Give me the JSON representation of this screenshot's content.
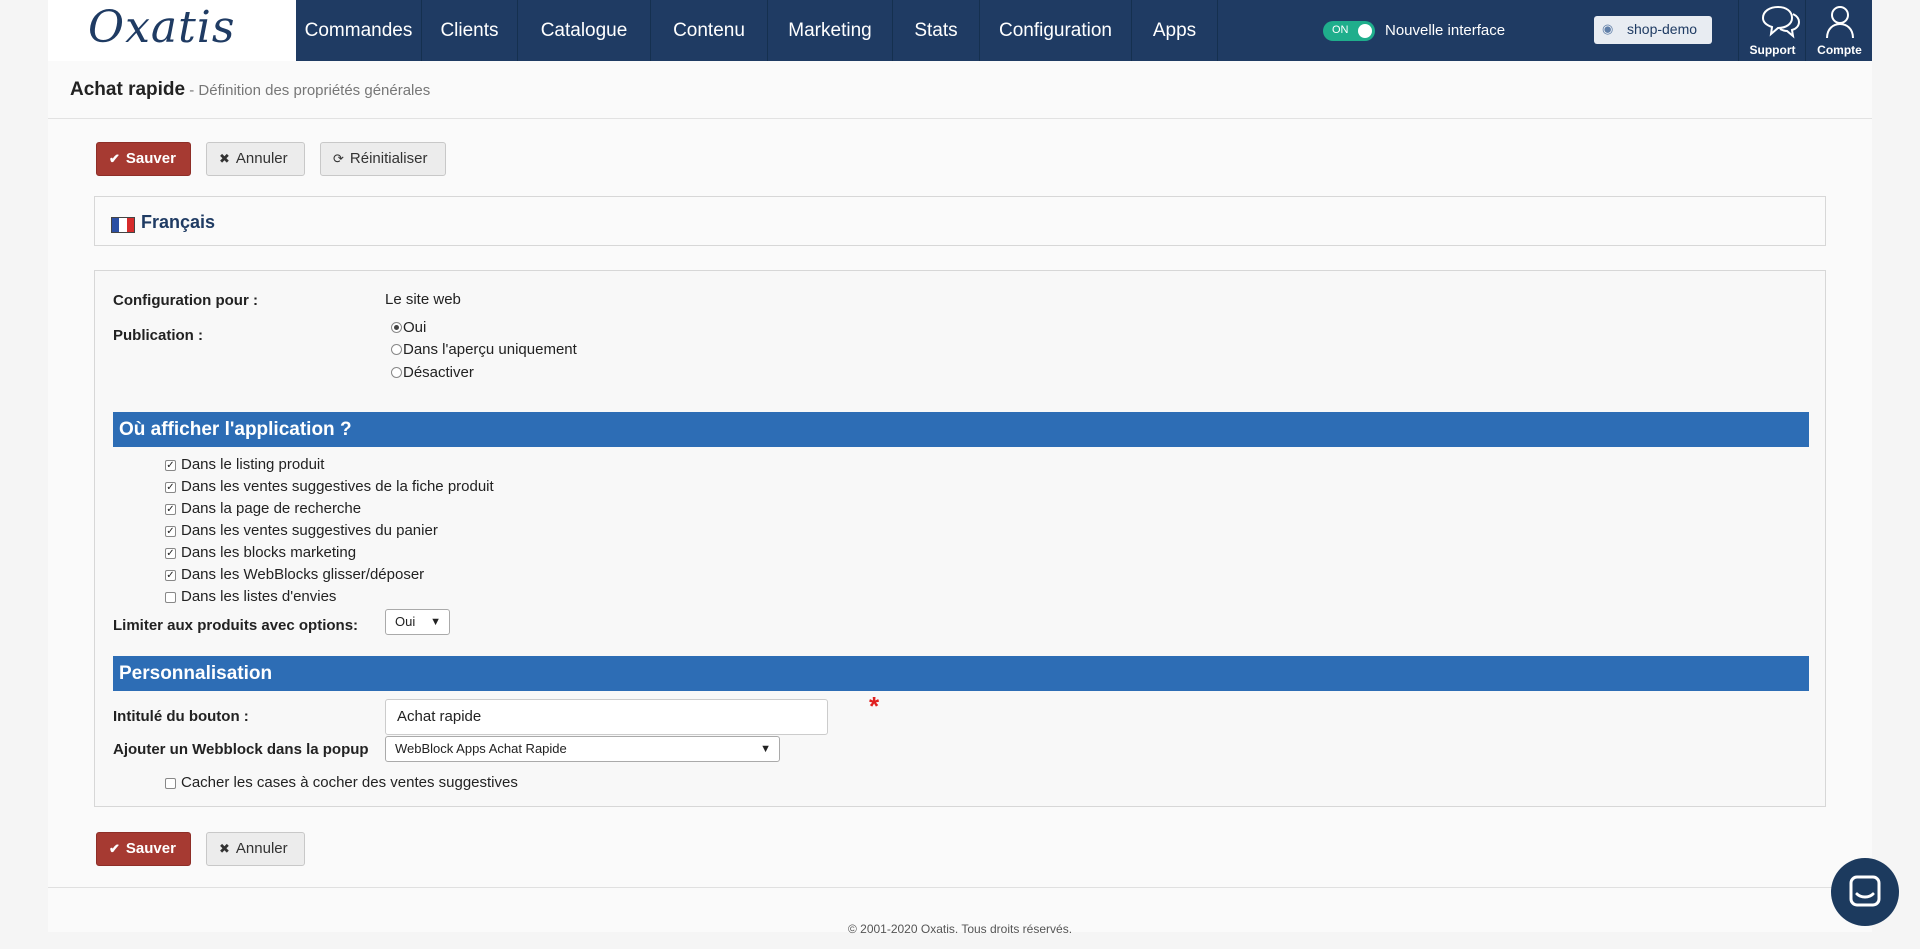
{
  "brand": {
    "logo_text": "Oxatis"
  },
  "nav": {
    "items": [
      {
        "label": "Commandes"
      },
      {
        "label": "Clients"
      },
      {
        "label": "Catalogue"
      },
      {
        "label": "Contenu"
      },
      {
        "label": "Marketing"
      },
      {
        "label": "Stats"
      },
      {
        "label": "Configuration"
      },
      {
        "label": "Apps"
      }
    ],
    "toggle_label": "ON",
    "new_interface": "Nouvelle interface",
    "shop_button": "shop-demo",
    "support": "Support",
    "account": "Compte"
  },
  "header": {
    "title": "Achat rapide",
    "subtitle": " - Définition des propriétés générales"
  },
  "toolbar": {
    "save": "Sauver",
    "cancel": "Annuler",
    "reset": "Réinitialiser"
  },
  "language": {
    "label": "Français"
  },
  "form": {
    "config_label": "Configuration pour :",
    "config_value": "Le site web",
    "publication_label": "Publication :",
    "publication_options": [
      {
        "label": "Oui",
        "selected": true
      },
      {
        "label": "Dans l'aperçu uniquement",
        "selected": false
      },
      {
        "label": "Désactiver",
        "selected": false
      }
    ],
    "section_where": "Où afficher l'application ?",
    "where_options": [
      {
        "label": "Dans le listing produit",
        "checked": true
      },
      {
        "label": "Dans les ventes suggestives de la fiche produit",
        "checked": true
      },
      {
        "label": "Dans la page de recherche",
        "checked": true
      },
      {
        "label": "Dans les ventes suggestives du panier",
        "checked": true
      },
      {
        "label": "Dans les blocks marketing",
        "checked": true
      },
      {
        "label": "Dans les WebBlocks glisser/déposer",
        "checked": true
      },
      {
        "label": "Dans les listes d'envies",
        "checked": false
      }
    ],
    "limit_label": "Limiter aux produits avec options:",
    "limit_value": "Oui",
    "section_custom": "Personnalisation",
    "button_label_label": "Intitulé du bouton :",
    "button_label_value": "Achat rapide",
    "required_mark": "*",
    "webblock_label": "Ajouter un Webblock dans la popup",
    "webblock_value": "WebBlock Apps Achat Rapide",
    "hide_checkboxes_label": "Cacher les cases à cocher des ventes suggestives",
    "hide_checkboxes_checked": false
  },
  "footer": {
    "copyright": "© 2001-2020 Oxatis. Tous droits réservés."
  },
  "colors": {
    "nav_bg": "#1f3b63",
    "save_red": "#a63a32",
    "section_blue": "#2d6db5",
    "toggle_green": "#1fae8c",
    "required_red": "#e02020"
  }
}
